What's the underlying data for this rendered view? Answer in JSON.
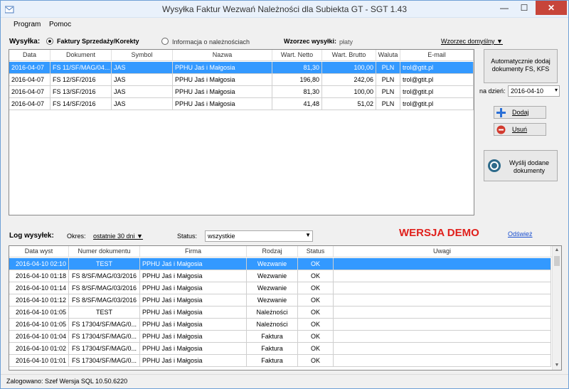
{
  "window": {
    "title": "Wysyłka Faktur Wezwań Należności dla Subiekta GT - SGT 1.43",
    "min": "—",
    "max": "☐",
    "close": "✕"
  },
  "menu": {
    "program": "Program",
    "help": "Pomoc"
  },
  "sending": {
    "label": "Wysyłka:",
    "option_invoices": "Faktury Sprzedaży/Korekty",
    "option_info": "Informacja o należnościach",
    "template_label": "Wzorzec wysyłki:",
    "template_value": "płaty",
    "template_default": "Wzorzec domyślny ▼"
  },
  "docs": {
    "headers": [
      "Data",
      "Dokument",
      "Symbol",
      "Nazwa",
      "Wart. Netto",
      "Wart. Brutto",
      "Waluta",
      "E-mail"
    ],
    "rows": [
      {
        "date": "2016-04-07",
        "doc": "FS 11/SF/MAG/04...",
        "symbol": "JAS",
        "name": "PPHU Jaś i Małgosia",
        "net": "81,30",
        "gross": "100,00",
        "cur": "PLN",
        "email": "trol@gtit.pl"
      },
      {
        "date": "2016-04-07",
        "doc": "FS 12/SF/2016",
        "symbol": "JAS",
        "name": "PPHU Jaś i Małgosia",
        "net": "196,80",
        "gross": "242,06",
        "cur": "PLN",
        "email": "trol@gtit.pl"
      },
      {
        "date": "2016-04-07",
        "doc": "FS 13/SF/2016",
        "symbol": "JAS",
        "name": "PPHU Jaś i Małgosia",
        "net": "81,30",
        "gross": "100,00",
        "cur": "PLN",
        "email": "trol@gtit.pl"
      },
      {
        "date": "2016-04-07",
        "doc": "FS 14/SF/2016",
        "symbol": "JAS",
        "name": "PPHU Jaś i Małgosia",
        "net": "41,48",
        "gross": "51,02",
        "cur": "PLN",
        "email": "trol@gtit.pl"
      }
    ]
  },
  "side": {
    "auto_add": "Automatycznie dodaj dokumenty FS, KFS",
    "date_label": "na dzień:",
    "date_value": "2016-04-10",
    "add": "Dodaj",
    "remove": "Usuń",
    "send": "Wyślij dodane dokumenty"
  },
  "log": {
    "label": "Log wysyłek:",
    "period_label": "Okres:",
    "period_value": "ostatnie 30 dni ▼",
    "status_label": "Status:",
    "status_value": "wszystkie",
    "demo": "WERSJA DEMO",
    "refresh": "Odśwież",
    "headers": [
      "Data wyst",
      "Numer dokumentu",
      "Firma",
      "Rodzaj",
      "Status",
      "Uwagi"
    ],
    "rows": [
      {
        "date": "2016-04-10 02:10",
        "num": "TEST",
        "firm": "PPHU Jaś i Małgosia",
        "type": "Wezwanie",
        "status": "OK",
        "notes": ""
      },
      {
        "date": "2016-04-10 01:18",
        "num": "FS 8/SF/MAG/03/2016",
        "firm": "PPHU Jaś i Małgosia",
        "type": "Wezwanie",
        "status": "OK",
        "notes": ""
      },
      {
        "date": "2016-04-10 01:14",
        "num": "FS 8/SF/MAG/03/2016",
        "firm": "PPHU Jaś i Małgosia",
        "type": "Wezwanie",
        "status": "OK",
        "notes": ""
      },
      {
        "date": "2016-04-10 01:12",
        "num": "FS 8/SF/MAG/03/2016",
        "firm": "PPHU Jaś i Małgosia",
        "type": "Wezwanie",
        "status": "OK",
        "notes": ""
      },
      {
        "date": "2016-04-10 01:05",
        "num": "TEST",
        "firm": "PPHU Jaś i Małgosia",
        "type": "Należności",
        "status": "OK",
        "notes": ""
      },
      {
        "date": "2016-04-10 01:05",
        "num": "FS 17304/SF/MAG/0...",
        "firm": "PPHU Jaś i Małgosia",
        "type": "Należności",
        "status": "OK",
        "notes": ""
      },
      {
        "date": "2016-04-10 01:04",
        "num": "FS 17304/SF/MAG/0...",
        "firm": "PPHU Jaś i Małgosia",
        "type": "Faktura",
        "status": "OK",
        "notes": ""
      },
      {
        "date": "2016-04-10 01:02",
        "num": "FS 17304/SF/MAG/0...",
        "firm": "PPHU Jaś i Małgosia",
        "type": "Faktura",
        "status": "OK",
        "notes": ""
      },
      {
        "date": "2016-04-10 01:01",
        "num": "FS 17304/SF/MAG/0...",
        "firm": "PPHU Jaś i Małgosia",
        "type": "Faktura",
        "status": "OK",
        "notes": ""
      }
    ]
  },
  "status": {
    "text": "Zalogowano: Szef  Wersja SQL 10.50.6220"
  },
  "colors": {
    "selection": "#3399ff",
    "demo": "#e0201c",
    "link": "#1a4fd0",
    "close": "#c7453a"
  }
}
